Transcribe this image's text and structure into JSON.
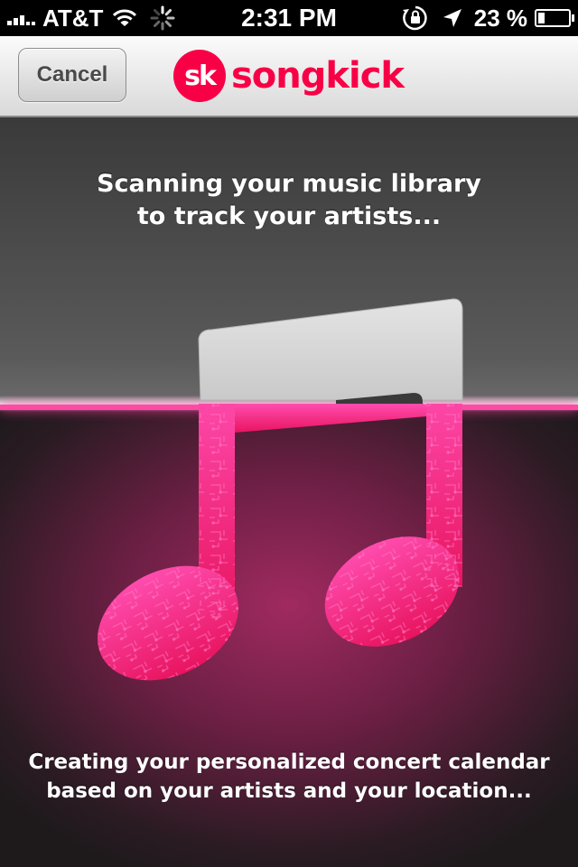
{
  "status_bar": {
    "carrier": "AT&T",
    "time": "2:31 PM",
    "battery_percent": "23 %",
    "battery_level": 0.23,
    "icons": [
      "signal-icon",
      "wifi-icon",
      "activity-spinner-icon",
      "orientation-lock-icon",
      "location-arrow-icon",
      "battery-icon"
    ]
  },
  "nav": {
    "cancel_label": "Cancel",
    "logo_badge": "sk",
    "logo_text": "songkick",
    "brand_color": "#f80046"
  },
  "main": {
    "heading_line1": "Scanning your music library",
    "heading_line2": "to track your artists...",
    "illustration": "music-note-icon",
    "footer_line1": "Creating your personalized concert calendar",
    "footer_line2": "based on your artists and your location..."
  }
}
